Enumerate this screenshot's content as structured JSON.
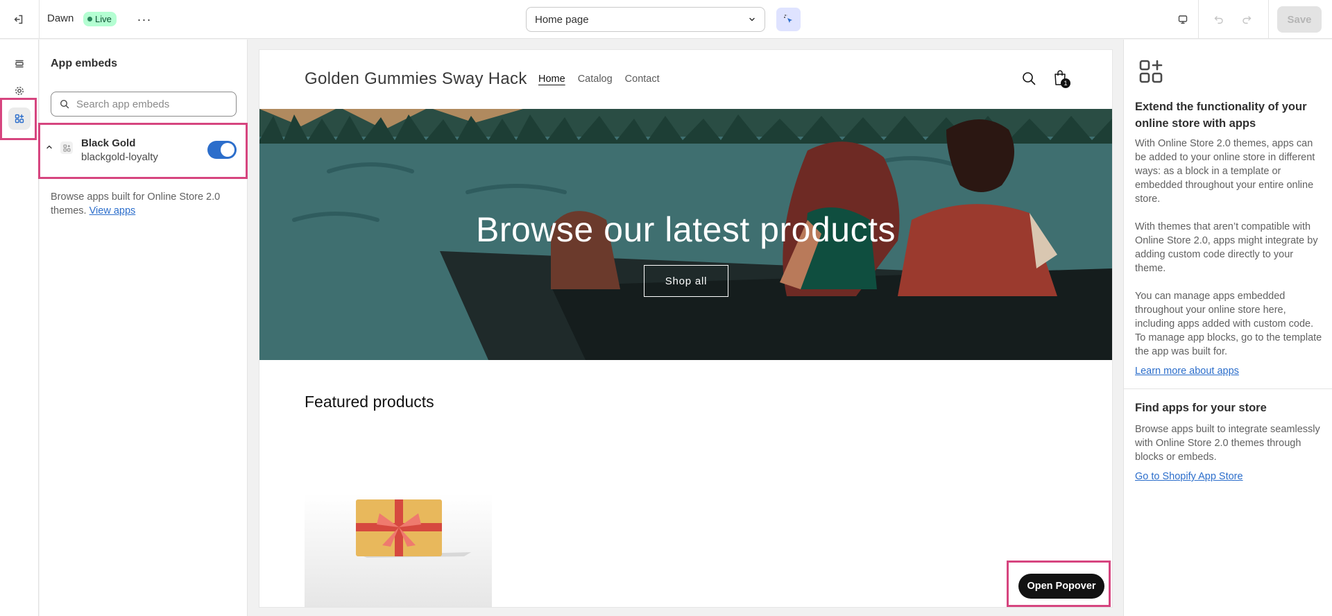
{
  "topbar": {
    "theme_name": "Dawn",
    "live_badge": "Live",
    "more_label": "···",
    "page_select_value": "Home page",
    "save_label": "Save"
  },
  "left_panel": {
    "title": "App embeds",
    "search_placeholder": "Search app embeds",
    "embed": {
      "name": "Black Gold",
      "handle": "blackgold-loyalty",
      "enabled": true
    },
    "browse_text": "Browse apps built for Online Store 2.0 themes.",
    "view_apps_link": "View apps"
  },
  "preview": {
    "store_name": "Golden Gummies Sway Hack",
    "nav": [
      "Home",
      "Catalog",
      "Contact"
    ],
    "cart_count": "1",
    "hero_title": "Browse our latest products",
    "hero_button": "Shop all",
    "featured_title": "Featured products",
    "popover_button": "Open Popover"
  },
  "right_panel": {
    "heading": "Extend the functionality of your online store with apps",
    "paragraphs": [
      "With Online Store 2.0 themes, apps can be added to your online store in different ways: as a block in a template or embedded throughout your entire online store.",
      "With themes that aren’t compatible with Online Store 2.0, apps might integrate by adding custom code directly to your theme.",
      "You can manage apps embedded throughout your online store here, including apps added with custom code. To manage app blocks, go to the template the app was built for."
    ],
    "learn_more_link": "Learn more about apps",
    "find_heading": "Find apps for your store",
    "find_text": "Browse apps built to integrate seamlessly with Online Store 2.0 themes through blocks or embeds.",
    "app_store_link": "Go to Shopify App Store"
  },
  "icons": {
    "exit": "exit-icon",
    "sections": "sections-icon",
    "settings": "gear-icon",
    "app_embeds": "app-embeds-icon",
    "inspector": "inspector-icon",
    "device": "desktop-icon",
    "undo": "undo-icon",
    "redo": "redo-icon"
  },
  "colors": {
    "accent": "#2c6ecb",
    "highlight": "#d6457f",
    "live_badge_bg": "#b4fed2"
  }
}
